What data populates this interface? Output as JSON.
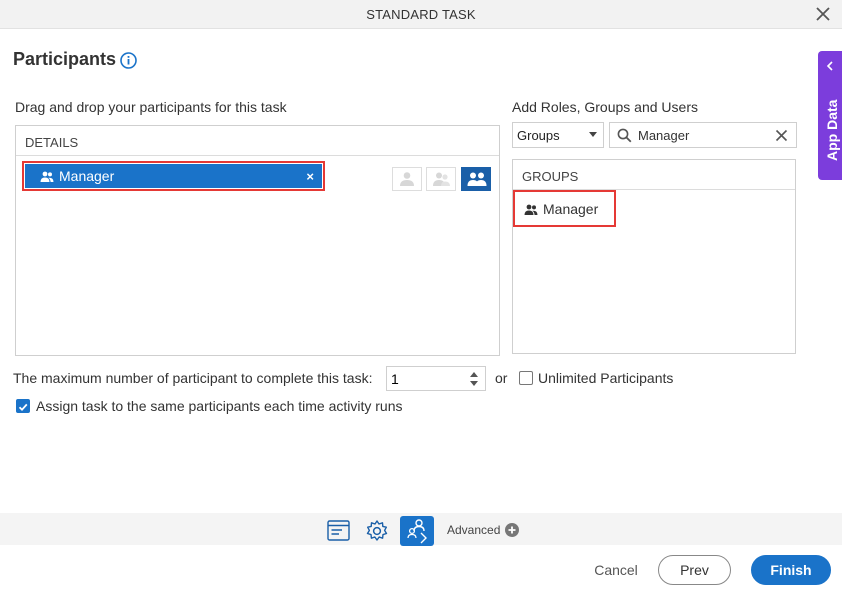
{
  "window": {
    "title": "STANDARD TASK"
  },
  "page": {
    "heading": "Participants"
  },
  "app_data_tab": {
    "label": "App Data"
  },
  "participants": {
    "section_label": "Drag and drop your participants for this task",
    "panel_header": "DETAILS",
    "selected": [
      {
        "label": "Manager",
        "remove": "×"
      }
    ]
  },
  "add_roles": {
    "section_label": "Add Roles, Groups and Users",
    "type_select": {
      "value": "Groups"
    },
    "search": {
      "value": "Manager",
      "placeholder": ""
    },
    "panel_header": "GROUPS",
    "results": [
      {
        "label": "Manager"
      }
    ]
  },
  "options": {
    "max_participants_label": "The maximum number of participant to complete this task:",
    "max_participants_value": "1",
    "or_label": "or",
    "unlimited_label": "Unlimited Participants",
    "unlimited_checked": false,
    "assign_same_label": "Assign task to the same participants each time activity runs",
    "assign_same_checked": true
  },
  "toolbar": {
    "advanced_label": "Advanced"
  },
  "footer": {
    "cancel": "Cancel",
    "prev": "Prev",
    "finish": "Finish"
  },
  "colors": {
    "primary": "#1a73c9",
    "app_data": "#7c3ddc",
    "highlight": "#e53935"
  }
}
